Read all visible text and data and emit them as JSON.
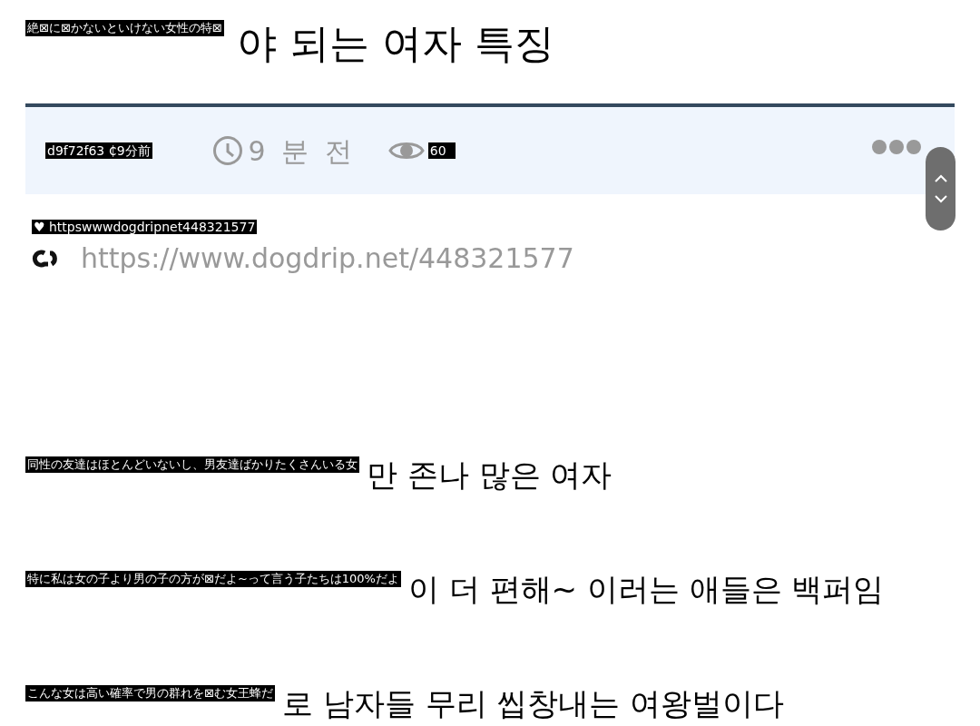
{
  "title": {
    "overlay": "絶⊠に⊠かないといけない女性の特⊠",
    "text": "야 되는 여자 특징"
  },
  "meta": {
    "overlay": "d9f72f63 ₵9分前",
    "time": "9 분 전",
    "views_overlay": "60"
  },
  "link": {
    "overlay": "♥ httpswwwdogdripnet448321577",
    "url": "https://www.dogdrip.net/448321577"
  },
  "lines": [
    {
      "overlay": "同性の友達はほとんどいないし、男友達ばかりたくさんいる女",
      "text": "만 존나 많은 여자"
    },
    {
      "overlay": "特に私は女の子より男の子の方が⊠だよ~って言う子たちは100%だよ",
      "text": "이 더 편해~ 이러는 애들은 백퍼임"
    },
    {
      "overlay": "こんな女は高い確率で男の群れを⊠む女王蜂だ",
      "text": "로 남자들 무리 씹창내는 여왕벌이다"
    }
  ]
}
